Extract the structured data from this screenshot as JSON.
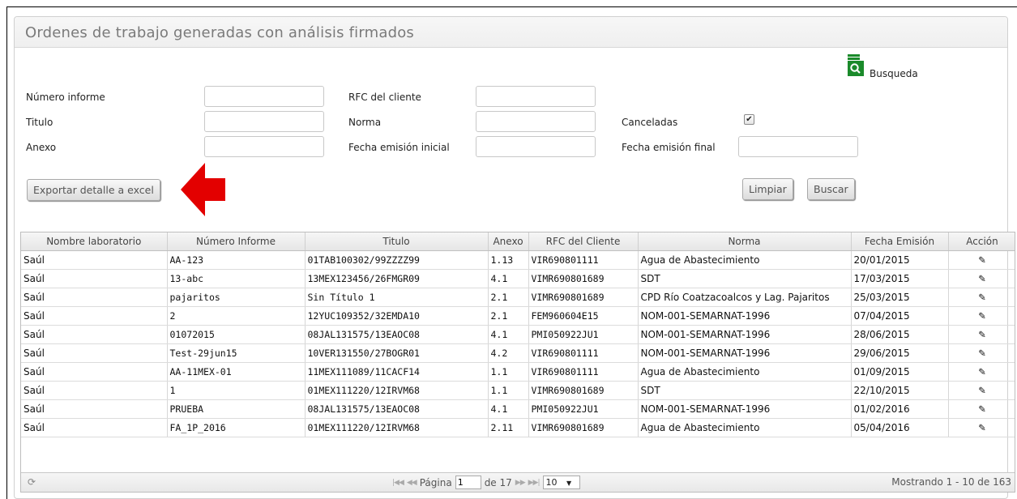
{
  "panel": {
    "title": "Ordenes de trabajo generadas con análisis firmados"
  },
  "search": {
    "label": "Busqueda",
    "icon": "search-document-icon",
    "icon_color": "#1a8a2a"
  },
  "form": {
    "numero_informe": {
      "label": "Número informe",
      "value": ""
    },
    "rfc_cliente": {
      "label": "RFC del cliente",
      "value": ""
    },
    "titulo": {
      "label": "Titulo",
      "value": ""
    },
    "norma": {
      "label": "Norma",
      "value": ""
    },
    "canceladas": {
      "label": "Canceladas",
      "checked": true,
      "glyph": "✔"
    },
    "anexo": {
      "label": "Anexo",
      "value": ""
    },
    "fecha_inicial": {
      "label": "Fecha emisión inicial",
      "value": ""
    },
    "fecha_final": {
      "label": "Fecha emisión final",
      "value": ""
    }
  },
  "buttons": {
    "export": "Exportar detalle a excel",
    "clear": "Limpiar",
    "search": "Buscar"
  },
  "annotation": {
    "arrow_color": "#e30000"
  },
  "grid": {
    "columns": [
      "Nombre laboratorio",
      "Número Informe",
      "Titulo",
      "Anexo",
      "RFC del Cliente",
      "Norma",
      "Fecha Emisión",
      "Acción"
    ],
    "action_icon": "edit-pencil-icon",
    "action_glyph": "✎",
    "rows": [
      [
        "Saúl",
        "AA-123",
        "01TAB100302/99ZZZZ99",
        "1.13",
        "VIR690801111",
        "Agua de Abastecimiento",
        "20/01/2015"
      ],
      [
        "Saúl",
        "13-abc",
        "13MEX123456/26FMGR09",
        "4.1",
        "VIMR690801689",
        "SDT",
        "17/03/2015"
      ],
      [
        "Saúl",
        "pajaritos",
        "Sin Título 1",
        "2.1",
        "VIMR690801689",
        "CPD Río Coatzacoalcos y Lag. Pajaritos",
        "25/03/2015"
      ],
      [
        "Saúl",
        "2",
        "12YUC109352/32EMDA10",
        "2.1",
        "FEM960604E15",
        "NOM-001-SEMARNAT-1996",
        "07/04/2015"
      ],
      [
        "Saúl",
        "01072015",
        "08JAL131575/13EAOC08",
        "4.1",
        "PMI050922JU1",
        "NOM-001-SEMARNAT-1996",
        "28/06/2015"
      ],
      [
        "Saúl",
        "Test-29jun15",
        "10VER131550/27BOGR01",
        "4.2",
        "VIR690801111",
        "NOM-001-SEMARNAT-1996",
        "29/06/2015"
      ],
      [
        "Saúl",
        "AA-11MEX-01",
        "11MEX111089/11CACF14",
        "1.1",
        "VIR690801111",
        "Agua de Abastecimiento",
        "01/09/2015"
      ],
      [
        "Saúl",
        "1",
        "01MEX111220/12IRVM68",
        "1.1",
        "VIMR690801689",
        "SDT",
        "22/10/2015"
      ],
      [
        "Saúl",
        "PRUEBA",
        "08JAL131575/13EAOC08",
        "4.1",
        "PMI050922JU1",
        "NOM-001-SEMARNAT-1996",
        "01/02/2016"
      ],
      [
        "Saúl",
        "FA_1P_2016",
        "01MEX111220/12IRVM68",
        "2.11",
        "VIMR690801689",
        "Agua de Abastecimiento",
        "05/04/2016"
      ]
    ]
  },
  "pager": {
    "refresh_glyph": "⟳",
    "first_glyph": "|◀◀",
    "prev_glyph": "◀◀",
    "next_glyph": "▶▶",
    "last_glyph": "▶▶|",
    "page_label": "Página",
    "page_value": "1",
    "of_label": "de 17",
    "page_size": "10",
    "page_size_arrow": "▼",
    "info": "Mostrando 1 - 10 de 163"
  }
}
